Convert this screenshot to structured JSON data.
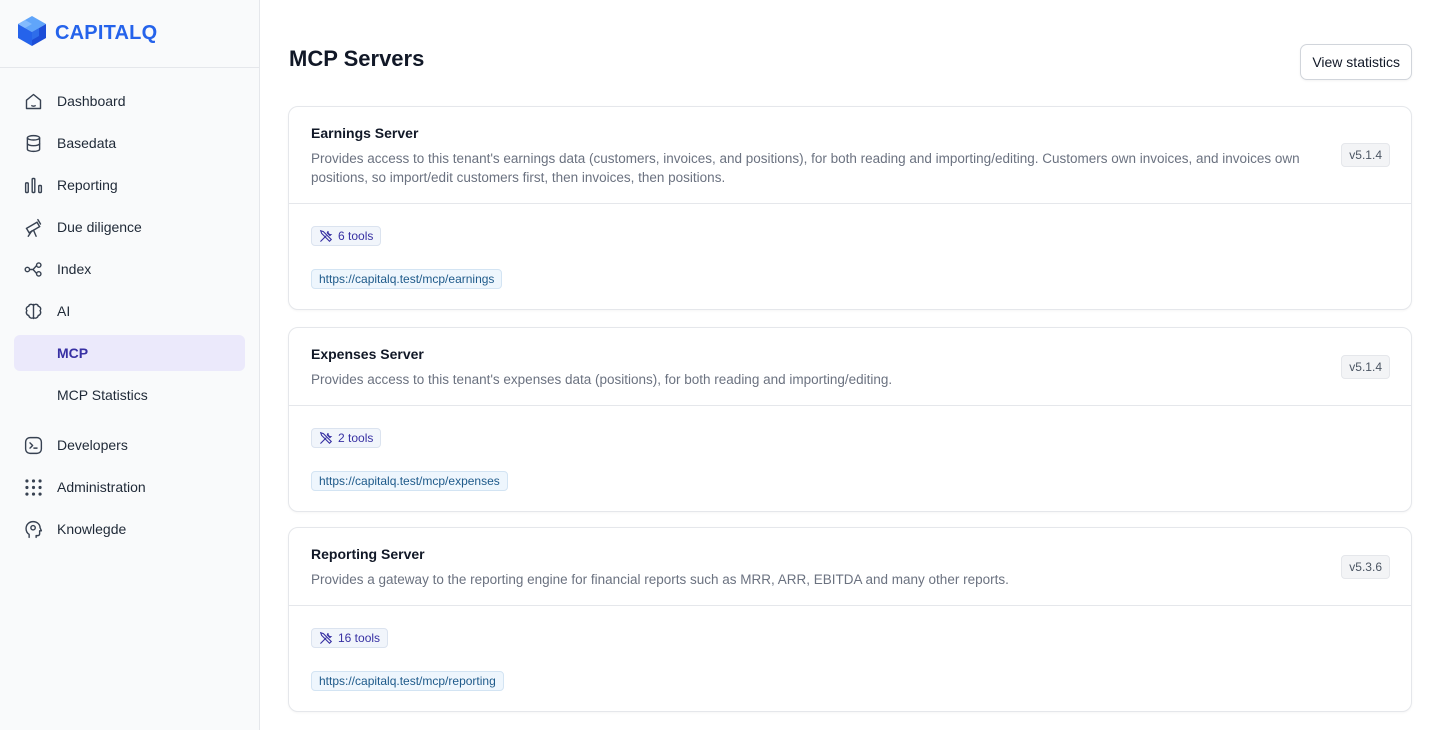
{
  "app": {
    "logo_text": "CAPITALQ"
  },
  "sidebar": {
    "items": [
      {
        "label": "Dashboard",
        "icon": "home-icon"
      },
      {
        "label": "Basedata",
        "icon": "database-icon"
      },
      {
        "label": "Reporting",
        "icon": "bar-chart-icon"
      },
      {
        "label": "Due diligence",
        "icon": "telescope-icon"
      },
      {
        "label": "Index",
        "icon": "nodes-icon"
      },
      {
        "label": "AI",
        "icon": "brain-icon"
      }
    ],
    "sub_items": [
      {
        "label": "MCP",
        "active": true
      },
      {
        "label": "MCP Statistics",
        "active": false
      }
    ],
    "bottom_items": [
      {
        "label": "Developers",
        "icon": "terminal-icon"
      },
      {
        "label": "Administration",
        "icon": "grid-icon"
      },
      {
        "label": "Knowlegde",
        "icon": "head-icon"
      }
    ]
  },
  "header": {
    "title": "MCP Servers",
    "stats_button": "View statistics"
  },
  "servers": [
    {
      "name": "Earnings Server",
      "description": "Provides access to this tenant's earnings data (customers, invoices, and positions), for both reading and importing/editing. Customers own invoices, and invoices own positions, so import/edit customers first, then invoices, then positions.",
      "version": "v5.1.4",
      "tools": "6 tools",
      "url": "https://capitalq.test/mcp/earnings"
    },
    {
      "name": "Expenses Server",
      "description": "Provides access to this tenant's expenses data (positions), for both reading and importing/editing.",
      "version": "v5.1.4",
      "tools": "2 tools",
      "url": "https://capitalq.test/mcp/expenses"
    },
    {
      "name": "Reporting Server",
      "description": "Provides a gateway to the reporting engine for financial reports such as MRR, ARR, EBITDA and many other reports.",
      "version": "v5.3.6",
      "tools": "16 tools",
      "url": "https://capitalq.test/mcp/reporting"
    }
  ],
  "colors": {
    "brand": "#2563eb",
    "active_nav_bg": "#ebe9fb",
    "active_nav_text": "#3730a3"
  }
}
